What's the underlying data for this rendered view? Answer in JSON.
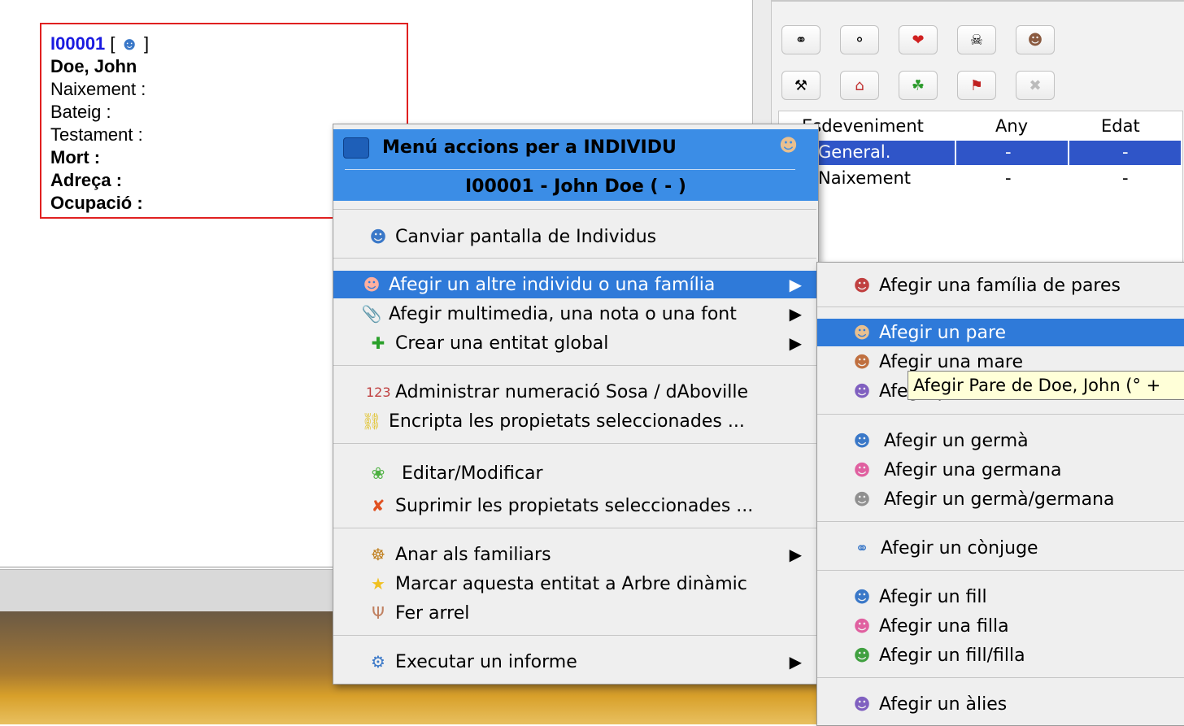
{
  "card": {
    "id": "I00001",
    "bracket_open": "[",
    "bracket_close": "]",
    "name": "Doe, John",
    "birth": "Naixement  :",
    "baptism": "Bateig :",
    "will": "Testament :",
    "death": "Mort  :",
    "address": "Adreça  :",
    "occupation": "Ocupació  :"
  },
  "events_table": {
    "headers": [
      "Esdeveniment",
      "Any",
      "Edat"
    ],
    "rows": [
      [
        "General.",
        "-",
        "-"
      ],
      [
        "Naixement",
        "-",
        "-"
      ]
    ]
  },
  "toolbar_icons": [
    "marriage-icon",
    "add-family-icon",
    "engagement-icon",
    "death-icon",
    "portrait-icon",
    "occupation-icon",
    "residence-icon",
    "emigration-icon",
    "graduation-icon",
    "delete-icon"
  ],
  "menu": {
    "title": "Menú accions per a INDIVIDU",
    "subtitle": "I00001 - John Doe ( - )",
    "items": [
      {
        "label": "Canviar pantalla de Individus"
      },
      {
        "label": "Afegir un altre individu o una família"
      },
      {
        "label": "Afegir multimedia, una nota o una font"
      },
      {
        "label": "Crear una entitat global"
      },
      {
        "label": "Administrar numeració Sosa / dAboville"
      },
      {
        "label": "Encripta les propietats seleccionades ..."
      },
      {
        "label": "Editar/Modificar"
      },
      {
        "label": "Suprimir les propietats seleccionades ..."
      },
      {
        "label": "Anar als familiars"
      },
      {
        "label": "Marcar aquesta entitat a Arbre dinàmic"
      },
      {
        "label": "Fer arrel"
      },
      {
        "label": "Executar un informe"
      }
    ]
  },
  "submenu": {
    "items": [
      {
        "label": "Afegir una família de pares"
      },
      {
        "label": "Afegir un pare"
      },
      {
        "label": "Afegir una mare"
      },
      {
        "label": "Afegir pares"
      },
      {
        "label": "Afegir un germà"
      },
      {
        "label": "Afegir una germana"
      },
      {
        "label": "Afegir un germà/germana"
      },
      {
        "label": "Afegir un cònjuge"
      },
      {
        "label": "Afegir un fill"
      },
      {
        "label": "Afegir una filla"
      },
      {
        "label": "Afegir un fill/filla"
      },
      {
        "label": "Afegir un àlies"
      }
    ]
  },
  "tooltip": "Afegir Pare de Doe, John (° +",
  "colors": {
    "selection": "#2f7ad9",
    "id_link": "#1a1ae0",
    "card_border": "#e02020"
  }
}
